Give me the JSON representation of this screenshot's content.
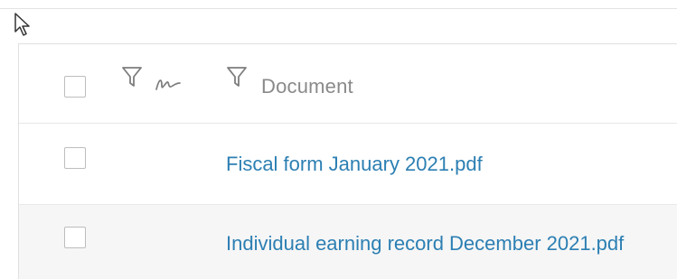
{
  "table": {
    "columns": [
      {
        "id": "select",
        "type": "checkbox"
      },
      {
        "id": "signature",
        "icons": [
          "filter-icon",
          "signature-icon"
        ]
      },
      {
        "id": "document",
        "label": "Document",
        "icons": [
          "filter-icon"
        ]
      }
    ],
    "rows": [
      {
        "document": "Fiscal form January 2021.pdf"
      },
      {
        "document": "Individual earning record December 2021.pdf"
      }
    ]
  },
  "colors": {
    "link": "#2c7fb3",
    "header_text": "#8a8a8a",
    "alt_row": "#f6f6f6",
    "border": "#e0e0e0"
  }
}
